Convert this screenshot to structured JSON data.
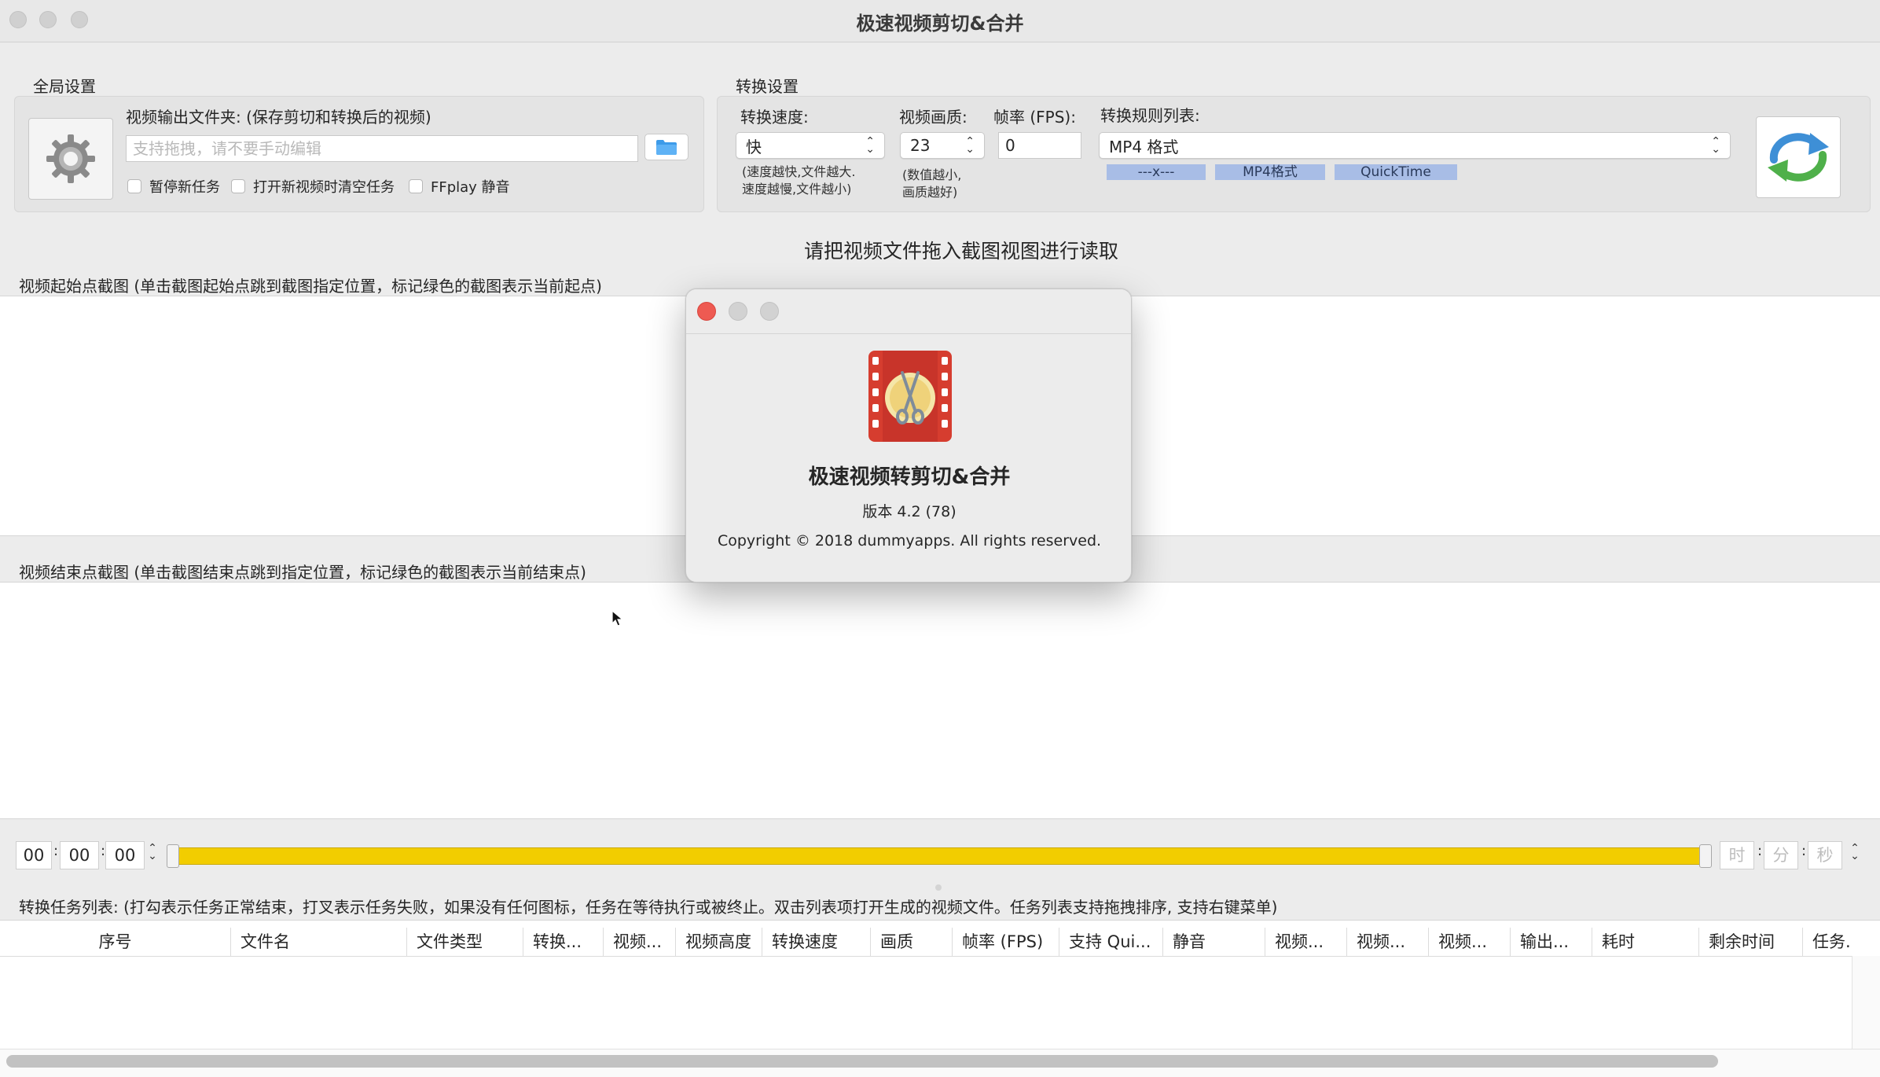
{
  "window": {
    "title": "极速视频剪切&合并"
  },
  "global_settings": {
    "label": "全局设置",
    "output_folder_label": "视频输出文件夹: (保存剪切和转换后的视频)",
    "output_folder_placeholder": "支持拖拽，请不要手动编辑",
    "checkboxes": [
      {
        "label": "暂停新任务",
        "checked": false
      },
      {
        "label": "打开新视频时清空任务",
        "checked": false
      },
      {
        "label": "FFplay 静音",
        "checked": false
      }
    ]
  },
  "convert_settings": {
    "label": "转换设置",
    "speed_label": "转换速度:",
    "speed_value": "快",
    "speed_note_1": "(速度越快,文件越大.",
    "speed_note_2": "速度越慢,文件越小)",
    "quality_label": "视频画质:",
    "quality_value": "23",
    "quality_note_1": "(数值越小,",
    "quality_note_2": "画质越好)",
    "fps_label": "帧率 (FPS):",
    "fps_value": "0",
    "rules_label": "转换规则列表:",
    "rules_value": "MP4 格式",
    "rule_tags": [
      "---x---",
      "MP4格式",
      "QuickTime"
    ]
  },
  "hint": "请把视频文件拖入截图视图进行读取",
  "start_snapshots_label": "视频起始点截图 (单击截图起始点跳到截图指定位置，标记绿色的截图表示当前起点)",
  "end_snapshots_label": "视频结束点截图 (单击截图结束点跳到指定位置，标记绿色的截图表示当前结束点)",
  "timeline": {
    "start": {
      "h": "00",
      "m": "00",
      "s": "00"
    },
    "end": {
      "h": "时",
      "m": "分",
      "s": "秒"
    },
    "slider_color": "#f2cd00"
  },
  "task_list": {
    "label": "转换任务列表: (打勾表示任务正常结束，打叉表示任务失败，如果没有任何图标，任务在等待执行或被终止。双击列表项打开生成的视频文件。任务列表支持拖拽排序, 支持右键菜单)",
    "columns": [
      "序号",
      "文件名",
      "文件类型",
      "转换...",
      "视频...",
      "视频高度",
      "转换速度",
      "画质",
      "帧率 (FPS)",
      "支持 Qui...",
      "静音",
      "视频...",
      "视频...",
      "视频...",
      "输出...",
      "耗时",
      "剩余时间",
      "任务."
    ]
  },
  "about": {
    "app_name": "极速视频转剪切&合并",
    "version": "版本 4.2 (78)",
    "copyright": "Copyright © 2018 dummyapps. All rights reserved.",
    "close_color": "#ee5a52"
  }
}
